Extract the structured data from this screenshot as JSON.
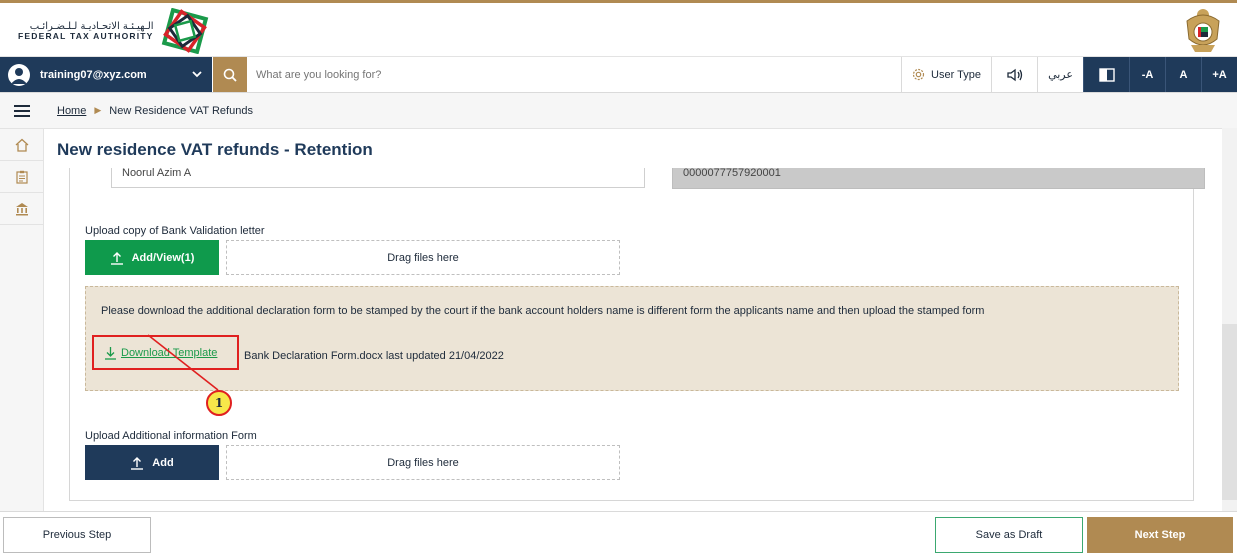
{
  "header": {
    "logo_arabic": "الـهيـئـة الاتحـاديـة لـلـضـرائـب",
    "logo_english": "FEDERAL TAX AUTHORITY"
  },
  "navbar": {
    "user_email": "training07@xyz.com",
    "search_placeholder": "What are you looking for?",
    "user_type_label": "User Type",
    "language_label": "عربي",
    "font_decrease": "-A",
    "font_normal": "A",
    "font_increase": "+A"
  },
  "breadcrumb": {
    "home": "Home",
    "current": "New Residence VAT Refunds"
  },
  "page": {
    "title": "New residence VAT refunds - Retention"
  },
  "form": {
    "account_holder_value": "Noorul Azim A",
    "account_number_value": "0000077757920001",
    "bank_letter_label": "Upload copy of Bank Validation letter",
    "bank_letter_button": "Add/View(1)",
    "drag_files_text": "Drag files here",
    "info_text": "Please download the additional declaration form to be stamped by the court if the bank account holders name is different form the applicants name and then upload the stamped form",
    "download_template_label": "Download Template",
    "template_file_text": "Bank Declaration Form.docx last updated 21/04/2022",
    "callout_number": "1",
    "additional_form_label": "Upload Additional information Form",
    "additional_form_button": "Add",
    "drag_files_text_2": "Drag files here"
  },
  "footer": {
    "previous_label": "Previous Step",
    "draft_label": "Save as Draft",
    "next_label": "Next Step"
  },
  "colors": {
    "navy": "#1f3a5a",
    "gold": "#b08a52",
    "green": "#0f9a4c",
    "callout_border": "#e02020"
  }
}
